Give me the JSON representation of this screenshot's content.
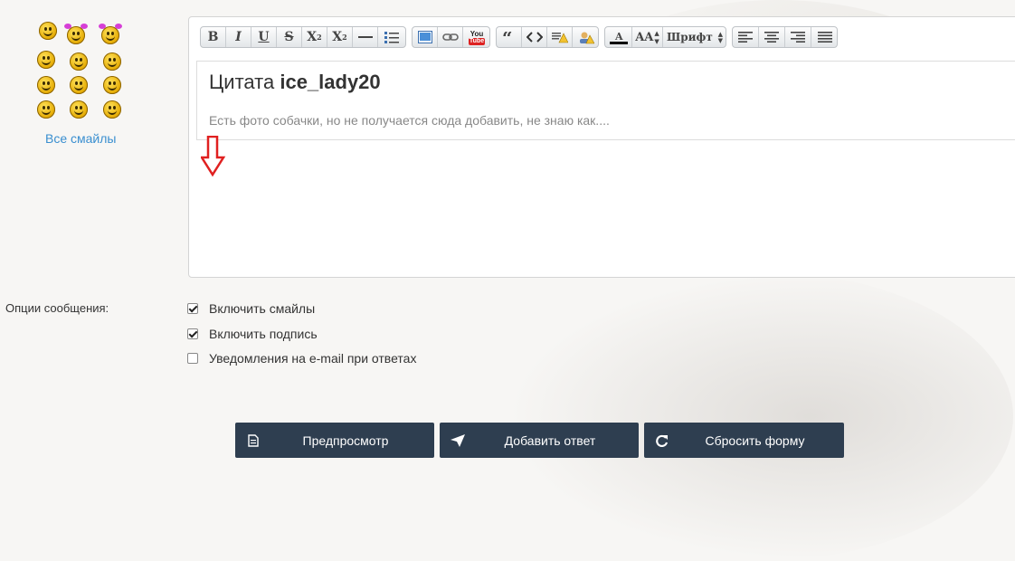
{
  "smileys": {
    "all_link": "Все смайлы",
    "items": [
      "smile",
      "bow-girl-1",
      "bow-girl-2",
      "wave",
      "hide",
      "grin",
      "dizzy",
      "thinking",
      "shocked",
      "cool",
      "nerd",
      "rolling"
    ]
  },
  "toolbar": {
    "bold": "B",
    "italic": "I",
    "underline": "U",
    "strike": "S",
    "superscript": "X",
    "subscript": "X",
    "font_size": "AA",
    "font_label": "Шрифт",
    "youtube_top": "You",
    "youtube_bottom": "Tube"
  },
  "quote": {
    "prefix": "Цитата",
    "author": "ice_lady20",
    "text": "Есть фото собачки, но не получается сюда добавить, не знаю как...."
  },
  "options": {
    "label": "Опции сообщения:",
    "items": [
      {
        "label": "Включить смайлы",
        "checked": true
      },
      {
        "label": "Включить подпись",
        "checked": true
      },
      {
        "label": "Уведомления на e-mail при ответах",
        "checked": false
      }
    ]
  },
  "buttons": {
    "preview": "Предпросмотр",
    "submit": "Добавить ответ",
    "reset": "Сбросить форму"
  },
  "colors": {
    "button_bg": "#2e3e50",
    "link": "#3a8fd0",
    "arrow": "#e02020"
  }
}
